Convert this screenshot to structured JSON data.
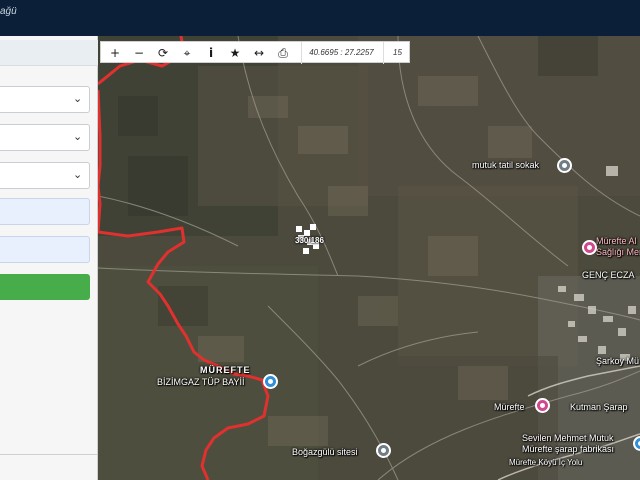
{
  "header": {
    "title_fragment": "ağü"
  },
  "toolbar": {
    "zoom_in_icon": "+",
    "zoom_out_icon": "−",
    "refresh_icon": "⟳",
    "locate_icon": "⌖",
    "info_icon": "i",
    "favorite_icon": "★",
    "measure_icon": "↔",
    "print_icon": "⎙",
    "coordinates": "40.6695 : 27.2257",
    "zoom_level": "15"
  },
  "map": {
    "parcel_label": "330/186",
    "places": {
      "mutuk_tatil": "mutuk tatil sokak",
      "murefte_health_1": "Mürefte Al",
      "murefte_health_2": "Sağlığı Merkez",
      "genc_eczane": "GENÇ ECZA",
      "murefte_village": "MÜREFTE",
      "bizimgaz": "BİZİMGAZ TÜP BAYİİ",
      "sarkoy_road": "Şarkoy Mü",
      "murefte": "Mürefte",
      "kutman": "Kutman Şarap",
      "sevilen_1": "Sevilen Mehmet Mutuk",
      "sevilen_2": "Mürefte şarap fabrikası",
      "bogazgulu": "Boğazgülü sitesi",
      "murefte_road": "Mürefte Köyü İç Yolu"
    },
    "boundary_color": "#e0312f"
  }
}
